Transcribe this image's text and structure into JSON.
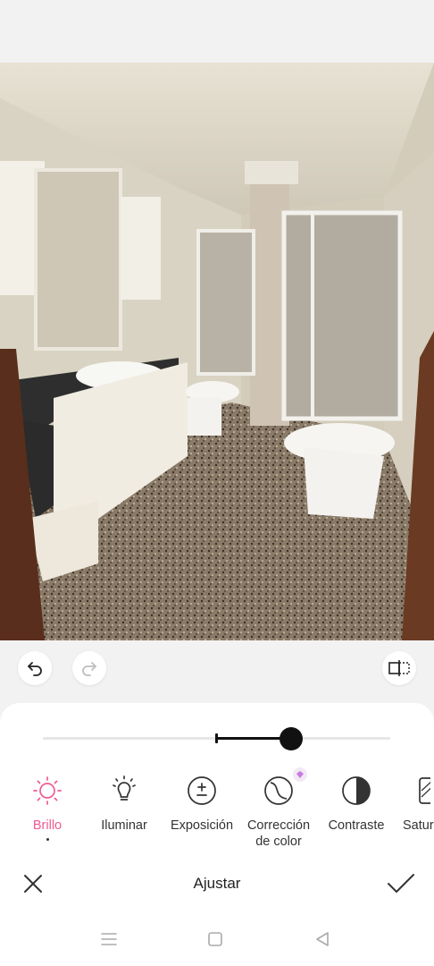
{
  "editor": {
    "title": "Ajustar",
    "slider": {
      "min": -100,
      "max": 100,
      "value": 43
    },
    "tools": [
      {
        "id": "brightness",
        "label": "Brillo",
        "icon": "sun-icon",
        "active": true
      },
      {
        "id": "illuminate",
        "label": "Iluminar",
        "icon": "lightbulb-icon",
        "active": false
      },
      {
        "id": "exposure",
        "label": "Exposición",
        "icon": "plus-minus-icon",
        "active": false
      },
      {
        "id": "color-correction",
        "label": "Corrección de color",
        "icon": "color-correction-icon",
        "active": false,
        "premium": true
      },
      {
        "id": "contrast",
        "label": "Contraste",
        "icon": "contrast-icon",
        "active": false
      },
      {
        "id": "saturation",
        "label": "Satur",
        "icon": "saturation-icon",
        "active": false
      }
    ]
  },
  "colors": {
    "accent": "#ef5a92",
    "icon": "#333333",
    "panel": "#ffffff",
    "background": "#f2f2f2"
  },
  "icons": {
    "undo": "undo-icon",
    "redo": "redo-icon",
    "compare": "compare-icon",
    "close": "close-icon",
    "confirm": "check-icon"
  }
}
